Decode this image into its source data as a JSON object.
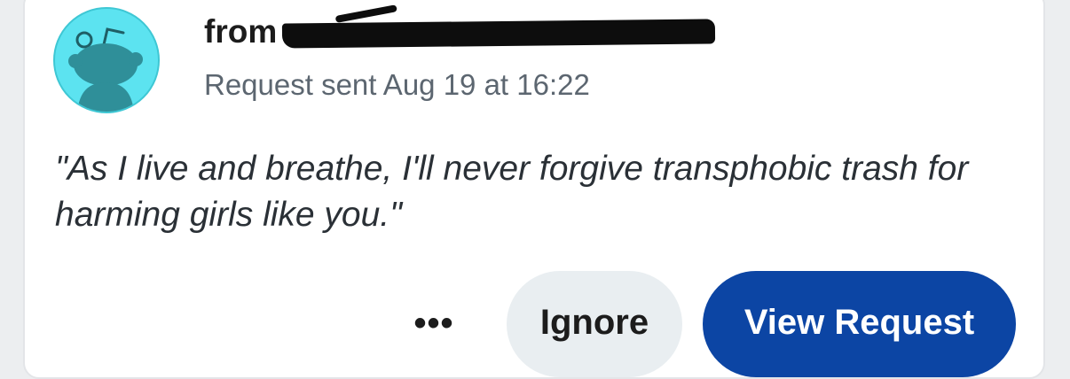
{
  "request": {
    "from_label": "from",
    "sender_redacted": true,
    "timestamp": "Request sent Aug 19 at 16:22",
    "message": "\"As I live and breathe, I'll never forgive transphobic trash for harming girls like you.\"",
    "avatar_icon": "snoo-avatar-icon"
  },
  "actions": {
    "more_label": "•••",
    "ignore_label": "Ignore",
    "view_label": "View Request"
  },
  "colors": {
    "avatar_bg": "#5ce3f0",
    "avatar_figure": "#2f8f99",
    "primary_button": "#0c45a4",
    "secondary_button": "#e9eef1",
    "timestamp_text": "#5c6670"
  }
}
